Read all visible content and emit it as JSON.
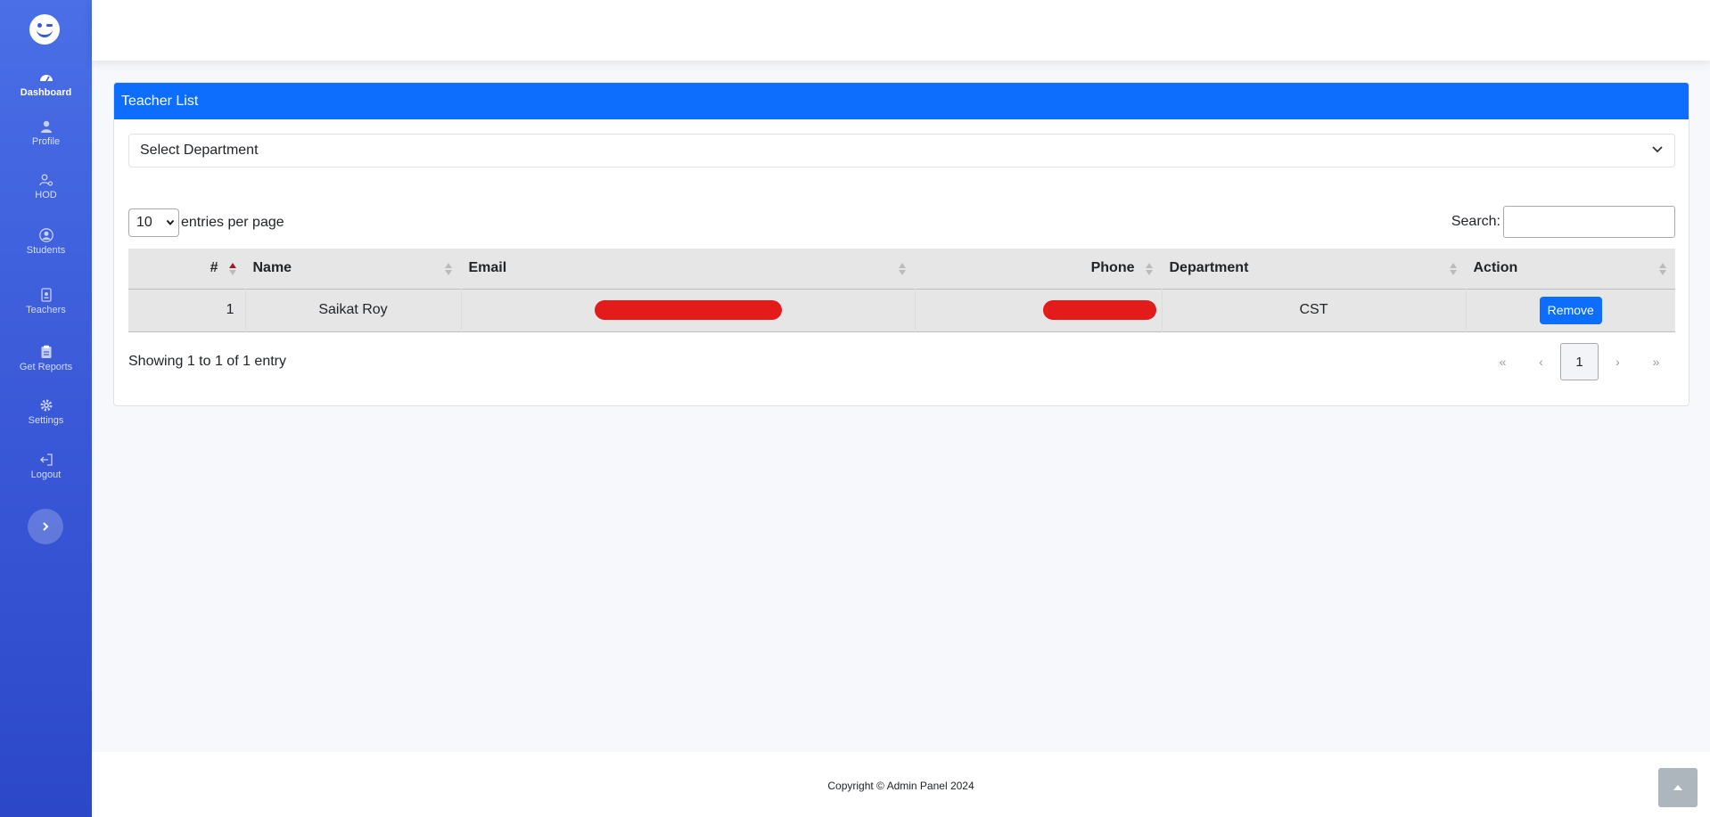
{
  "sidebar": {
    "items": [
      {
        "label": "Dashboard",
        "icon": "gauge-icon",
        "active": true
      },
      {
        "label": "Profile",
        "icon": "user-icon"
      },
      {
        "label": "HOD",
        "icon": "user-cog-icon"
      },
      {
        "label": "Students",
        "icon": "user-circle-icon"
      },
      {
        "label": "Teachers",
        "icon": "id-badge-icon"
      },
      {
        "label": "Get Reports",
        "icon": "clipboard-icon"
      },
      {
        "label": "Settings",
        "icon": "gear-icon"
      },
      {
        "label": "Logout",
        "icon": "logout-icon"
      }
    ],
    "toggle_icon": "chevron-right-icon"
  },
  "card": {
    "title": "Teacher List",
    "department_select": {
      "selected": "Select Department"
    },
    "entries": {
      "value": "10",
      "label": "entries per page"
    },
    "search": {
      "label": "Search:",
      "value": ""
    },
    "table": {
      "headers": [
        "#",
        "Name",
        "Email",
        "Phone",
        "Department",
        "Action"
      ],
      "sorted_column": "#",
      "sort_direction": "ascending",
      "rows": [
        {
          "index": "1",
          "name": "Saikat Roy",
          "email": "[redacted]",
          "phone": "[redacted]",
          "department": "CST",
          "action": "Remove"
        }
      ]
    },
    "info": "Showing 1 to 1 of 1 entry",
    "pagination": {
      "first": "«",
      "prev": "‹",
      "current": "1",
      "next": "›",
      "last": "»"
    }
  },
  "footer": {
    "copyright": "Copyright © Admin Panel 2024"
  },
  "colors": {
    "primary": "#0d6efd",
    "sidebar": "#3a59d8",
    "redaction": "#e31b1b",
    "sort_active": "#9b1c24"
  }
}
